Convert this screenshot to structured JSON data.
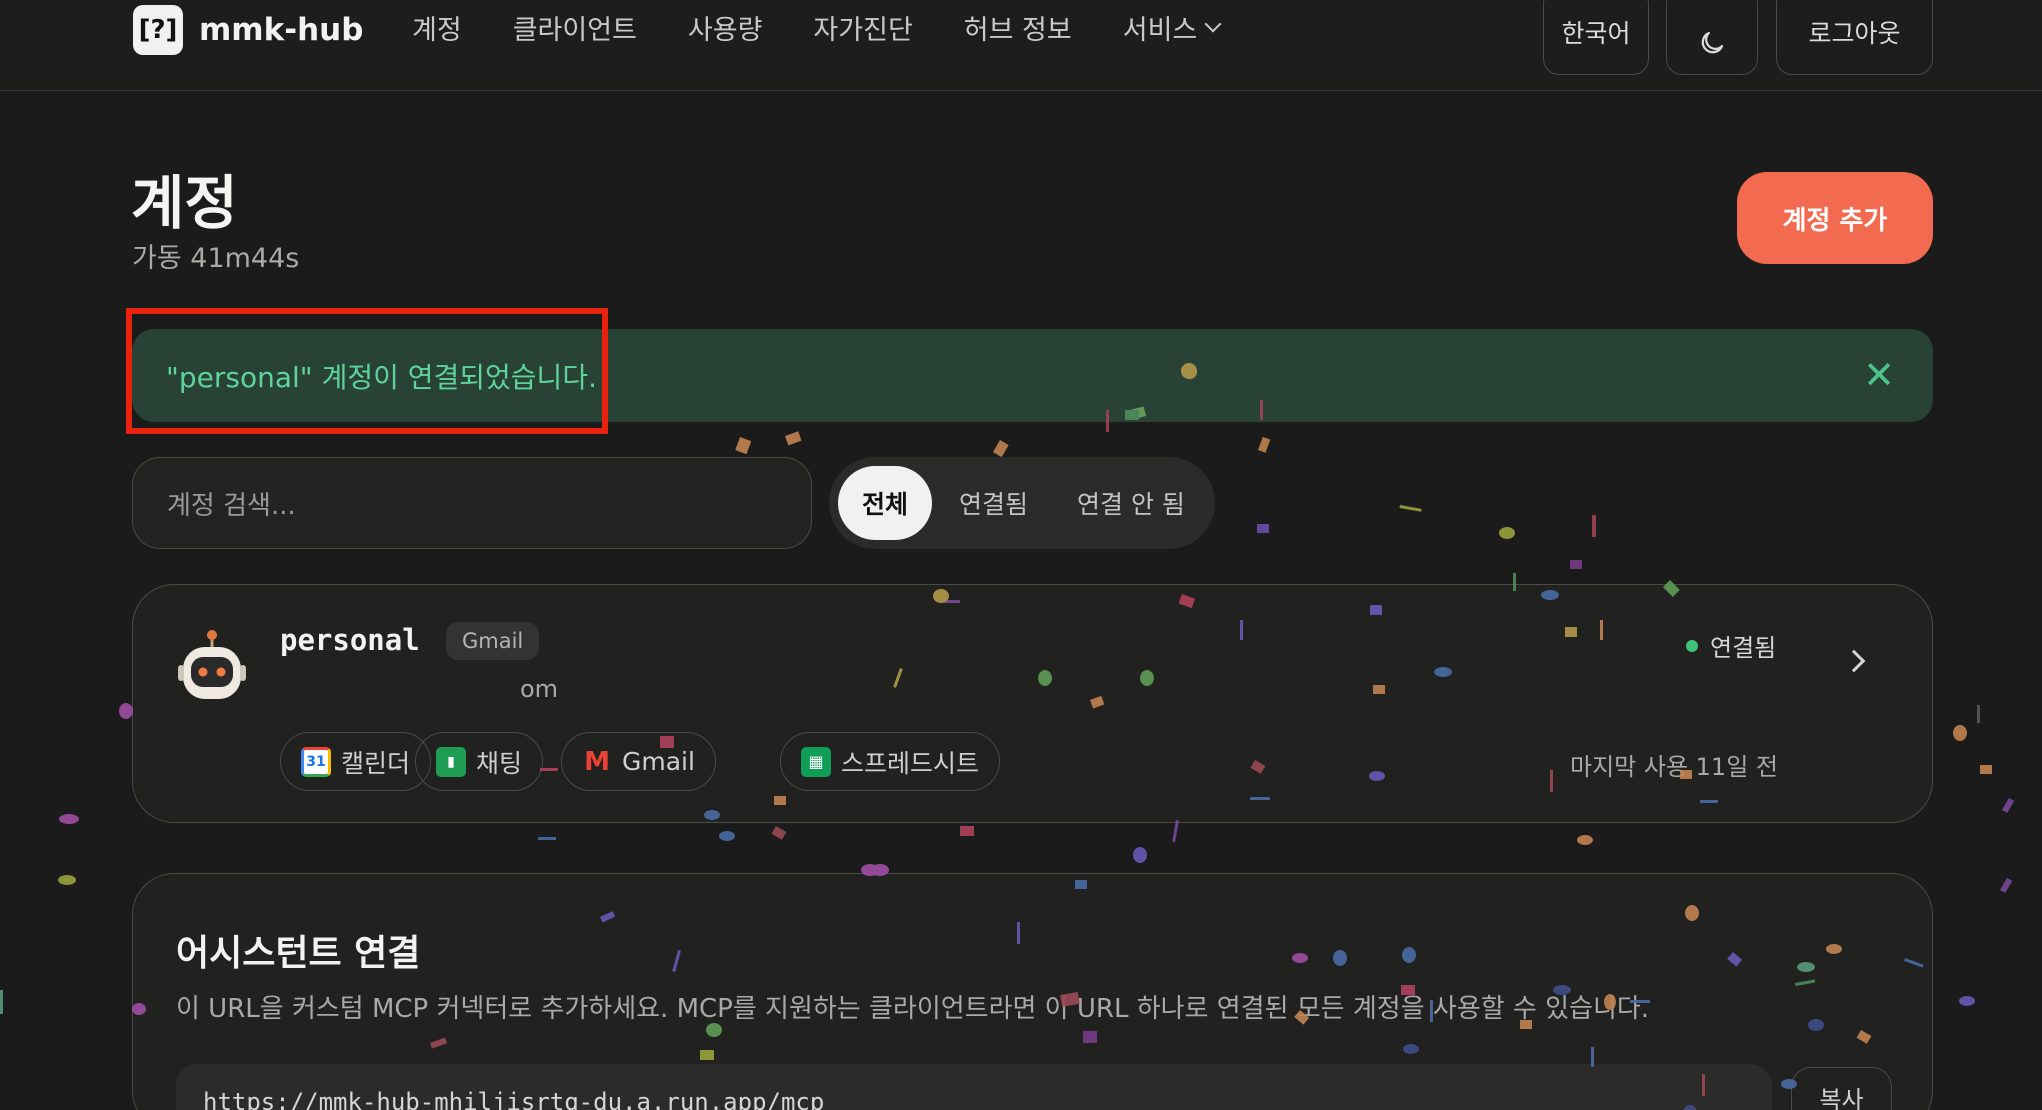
{
  "app": {
    "name": "mmk-hub"
  },
  "nav": {
    "items": [
      "계정",
      "클라이언트",
      "사용량",
      "자가진단",
      "허브 정보",
      "서비스"
    ]
  },
  "header": {
    "language": "한국어",
    "logout": "로그아웃",
    "theme_icon": "moon-icon"
  },
  "page": {
    "title": "계정",
    "uptime": "가동 41m44s",
    "add_button": "계정 추가"
  },
  "banner": {
    "message": "\"personal\" 계정이 연결되었습니다.",
    "close_icon": "close-icon"
  },
  "search": {
    "placeholder": "계정 검색..."
  },
  "filters": {
    "items": [
      "전체",
      "연결됨",
      "연결 안 됨"
    ],
    "active": "전체"
  },
  "account": {
    "name": "personal",
    "provider_badge": "Gmail",
    "email_fragment": "om",
    "status": "연결됨",
    "services": [
      "캘린더",
      "채팅",
      "Gmail",
      "스프레드시트"
    ],
    "last_used": "마지막 사용 11일 전"
  },
  "assistant": {
    "title": "어시스턴트 연결",
    "description": "이 URL을 커스텀 MCP 커넥터로 추가하세요. MCP를 지원하는 클라이언트라면 이 URL 하나로 연결된 모든 계정을 사용할 수 있습니다.",
    "url": "https://mmk-hub-mhiljisrtq-du.a.run.app/mcp",
    "copy_button": "복사"
  },
  "colors": {
    "accent": "#f26a4f",
    "success": "#3fc27c",
    "banner_bg": "#284236",
    "highlight": "#e8220c"
  }
}
